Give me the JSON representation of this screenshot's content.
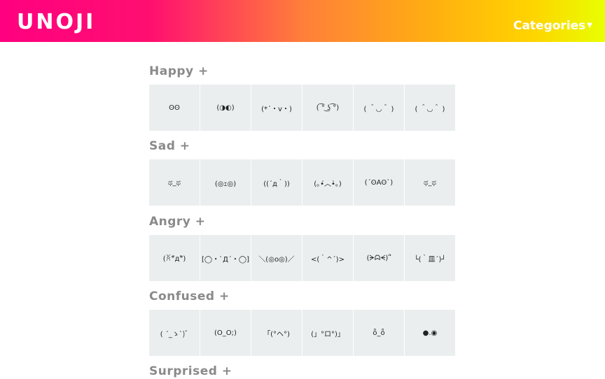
{
  "header": {
    "logo": "UNOJI",
    "categories_label": "Categories",
    "caret": "▼"
  },
  "sections": [
    {
      "title": "Happy +",
      "emojis": [
        "ʘʘ",
        "(◑◐)",
        "(*´・v・)",
        "( ͡° ͜ʖ ͡°)",
        "( ＾◡＾ )",
        "( ＾◡＾ )"
      ]
    },
    {
      "title": "Sad +",
      "emojis": [
        "ಥ_ಥ",
        "(◎ｪ◎)",
        "((´д｀))",
        "(｡•́︿•̀｡)",
        "(´ʘAʘ`)",
        "ಥ_ಥ"
      ]
    },
    {
      "title": "Angry +",
      "emojis": [
        "(ꐦ°᷄д°᷅)",
        "[◯・`Д´・◯]",
        "＼(◎o◎)／",
        "<(｀^´)>",
        "(ᗒᗣᗕ)՞",
        "└(｀皿´)┘"
      ]
    },
    {
      "title": "Confused +",
      "emojis": [
        "( ´_ゝ`)ﾞ",
        "(O_O;)",
        "「(°ヘ°)",
        "(」°ロ°)」",
        "ȫ_ȫ",
        "●.◉"
      ]
    },
    {
      "title": "Surprised +",
      "emojis": []
    }
  ]
}
